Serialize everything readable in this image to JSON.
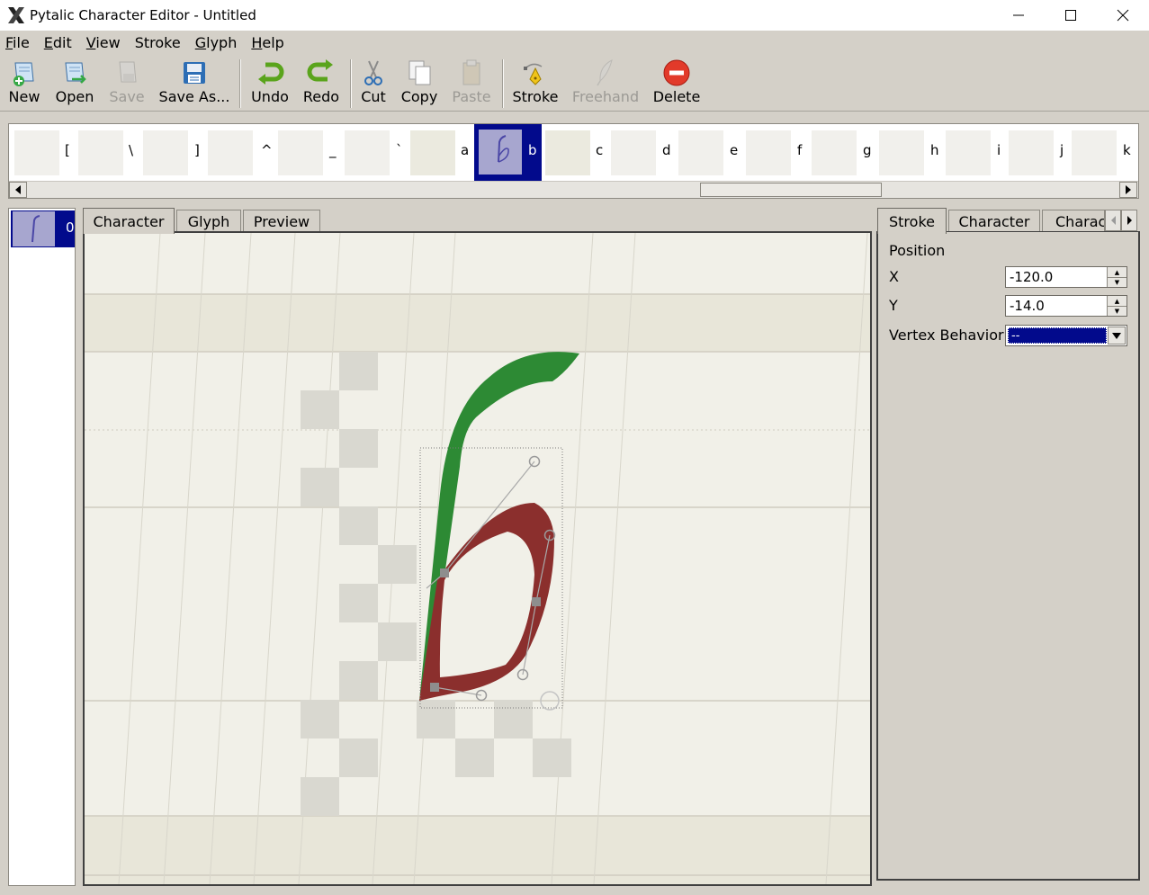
{
  "window": {
    "title": "Pytalic Character Editor - Untitled",
    "minimize_glyph": "—",
    "maximize_glyph": "☐",
    "close_glyph": "✕"
  },
  "menu": [
    {
      "label_ul": "F",
      "label_rest": "ile"
    },
    {
      "label_ul": "E",
      "label_rest": "dit"
    },
    {
      "label_ul": "V",
      "label_rest": "iew"
    },
    {
      "label_ul": "",
      "label_rest": "Stroke"
    },
    {
      "label_ul": "G",
      "label_rest": "lyph"
    },
    {
      "label_ul": "H",
      "label_rest": "elp"
    }
  ],
  "toolbar": {
    "new": "New",
    "open": "Open",
    "save": "Save",
    "save_as": "Save As...",
    "undo": "Undo",
    "redo": "Redo",
    "cut": "Cut",
    "copy": "Copy",
    "paste": "Paste",
    "stroke": "Stroke",
    "freehand": "Freehand",
    "delete": "Delete"
  },
  "glyph_strip": {
    "labels": [
      "[",
      "\\",
      "]",
      "^",
      "_",
      "`",
      "a",
      "b",
      "c",
      "d",
      "e",
      "f",
      "g",
      "h",
      "i",
      "j",
      "k"
    ],
    "selected": "b"
  },
  "stroke_list": {
    "items": [
      {
        "index": "0"
      }
    ]
  },
  "canvas_tabs": [
    "Character",
    "Glyph",
    "Preview"
  ],
  "active_canvas_tab": "Character",
  "panel_tabs": [
    "Stroke",
    "Character",
    "Charac"
  ],
  "stroke_panel": {
    "section": "Position",
    "x_label": "X",
    "x_value": "-120.0",
    "y_label": "Y",
    "y_value": "-14.0",
    "vertex_label": "Vertex Behavior",
    "vertex_value": "--"
  },
  "colors": {
    "stroke_green": "#2d8a34",
    "stroke_red": "#8b2f2d",
    "selection": "#020a8c"
  }
}
